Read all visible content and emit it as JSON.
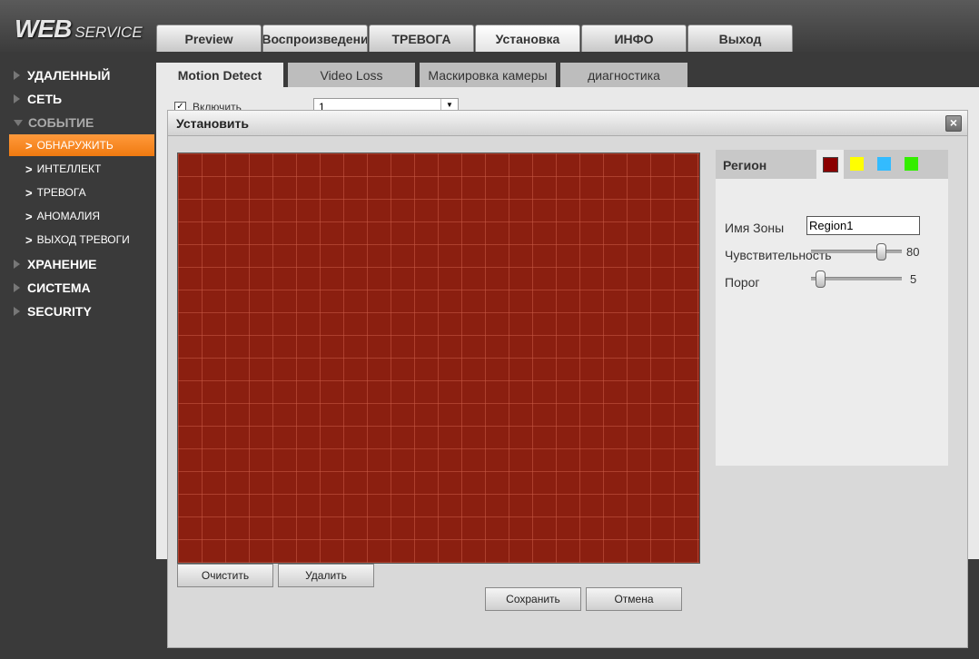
{
  "logo": {
    "web": "WEB",
    "service": "SERVICE"
  },
  "main_tabs": [
    "Preview",
    "Воспроизведени",
    "ТРЕВОГА",
    "Установка",
    "ИНФО",
    "Выход"
  ],
  "sidebar": {
    "items": [
      {
        "label": "УДАЛЕННЫЙ"
      },
      {
        "label": "СЕТЬ"
      },
      {
        "label": "СОБЫТИЕ"
      },
      {
        "label": "ОБНАРУЖИТЬ"
      },
      {
        "label": "ИНТЕЛЛЕКТ"
      },
      {
        "label": "ТРЕВОГА"
      },
      {
        "label": "АНОМАЛИЯ"
      },
      {
        "label": "ВЫХОД ТРЕВОГИ"
      },
      {
        "label": "ХРАНЕНИЕ"
      },
      {
        "label": "СИСТЕМА"
      },
      {
        "label": "SECURITY"
      }
    ]
  },
  "sub_tabs": [
    "Motion Detect",
    "Video Loss",
    "Маскировка камеры",
    "диагностика"
  ],
  "background_form": {
    "enable_label": "Включить",
    "channel_value": "1"
  },
  "modal": {
    "title": "Установить",
    "close_glyph": "×",
    "region": {
      "title": "Регион",
      "colors": [
        "#8b0000",
        "#ffff00",
        "#33bbff",
        "#33ee00"
      ],
      "zone_name_label": "Имя Зоны",
      "zone_name_value": "Region1",
      "sensitivity_label": "Чувствительность",
      "sensitivity_value": "80",
      "threshold_label": "Порог",
      "threshold_value": "5"
    },
    "buttons": {
      "clear": "Очистить",
      "delete": "Удалить",
      "save": "Сохранить",
      "cancel": "Отмена"
    }
  }
}
